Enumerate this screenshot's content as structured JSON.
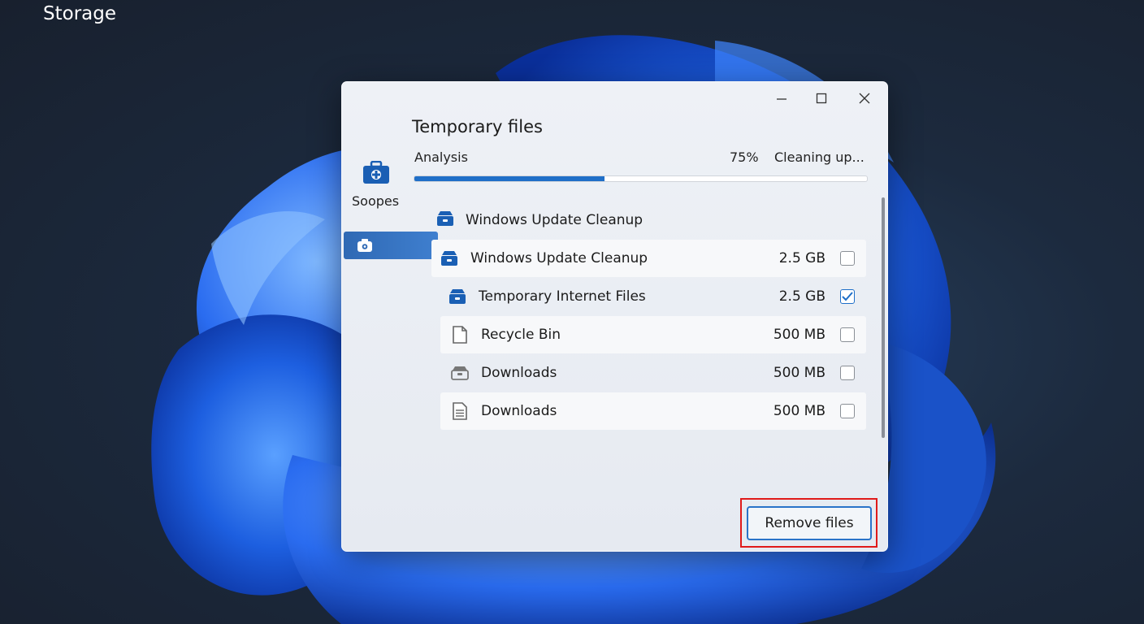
{
  "desktop": {
    "title": "Storage"
  },
  "window": {
    "controls": {
      "minimize_icon": "minimize-icon",
      "maximize_icon": "maximize-icon",
      "close_icon": "close-icon"
    },
    "sidebar": {
      "label": "Soopes",
      "icon": "toolbox-icon",
      "selected_icon": "gear-icon"
    },
    "panel": {
      "title": "Temporary files",
      "analysis_label": "Analysis",
      "progress_percent_text": "75%",
      "progress_value": 0.42,
      "status": "Cleaning up...",
      "group": {
        "label": "Windows Update Cleanup",
        "icon": "drawer-icon"
      },
      "items": [
        {
          "name": "Windows Update Cleanup",
          "size": "2.5 GB",
          "checked": false,
          "icon": "drawer-icon"
        },
        {
          "name": "Temporary Internet Files",
          "size": "2.5 GB",
          "checked": true,
          "icon": "drawer-icon"
        },
        {
          "name": "Recycle Bin",
          "size": "500 MB",
          "checked": false,
          "icon": "file-icon"
        },
        {
          "name": "Downloads",
          "size": "500 MB",
          "checked": false,
          "icon": "tray-icon"
        },
        {
          "name": "Downloads",
          "size": "500 MB",
          "checked": false,
          "icon": "document-icon"
        }
      ],
      "remove_button": "Remove files"
    }
  },
  "colors": {
    "accent": "#1f6fc8",
    "highlight": "#e01a1a"
  }
}
